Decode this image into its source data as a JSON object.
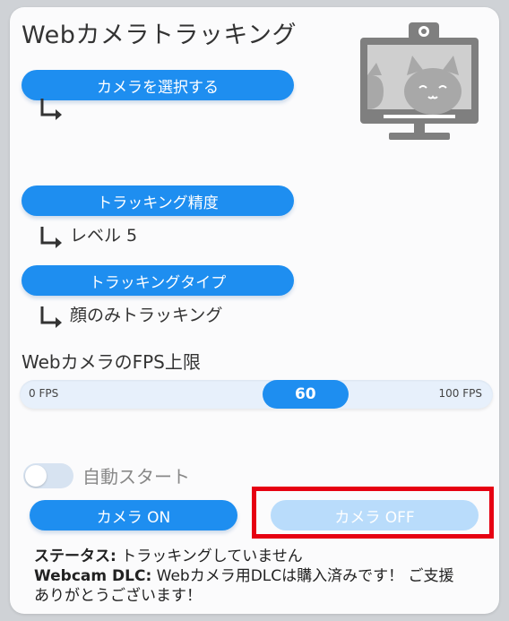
{
  "title": "Webカメラトラッキング",
  "select_camera": {
    "button_label": "カメラを選択する",
    "value": ""
  },
  "tracking_precision": {
    "button_label": "トラッキング精度",
    "value": "レベル 5"
  },
  "tracking_type": {
    "button_label": "トラッキングタイプ",
    "value": "顔のみトラッキング"
  },
  "fps": {
    "label": "WebカメラのFPS上限",
    "min_label": "0 FPS",
    "max_label": "100 FPS",
    "value": 60,
    "value_label": "60"
  },
  "autostart": {
    "label": "自動スタート",
    "enabled": false
  },
  "camera_on_label": "カメラ ON",
  "camera_off_label": "カメラ OFF",
  "status": {
    "status_key": "ステータス:",
    "status_value": "トラッキングしていません",
    "dlc_key": "Webcam DLC:",
    "dlc_value": "Webカメラ用DLCは購入済みです！ ご支援ありがとうございます！"
  },
  "colors": {
    "accent": "#1e8ef0",
    "accent_disabled": "#b9dcfb",
    "highlight_box": "#e60012",
    "monitor": "#7f7f7f"
  },
  "icons": {
    "monitor": "webcam-monitor-cat-icon",
    "arrow": "corner-arrow-icon"
  }
}
